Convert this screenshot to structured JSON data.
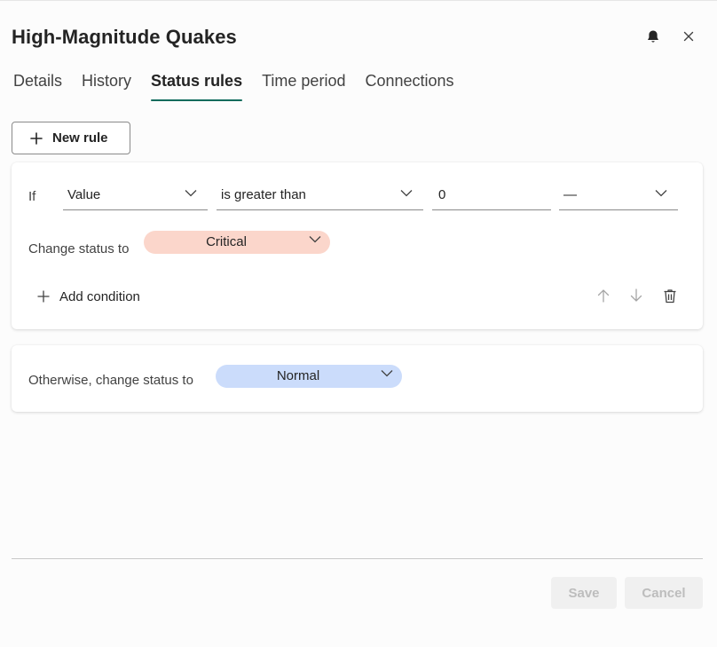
{
  "header": {
    "title": "High-Magnitude Quakes",
    "icons": [
      "bell-icon",
      "close-icon"
    ]
  },
  "tabs": [
    {
      "label": "Details",
      "active": false
    },
    {
      "label": "History",
      "active": false
    },
    {
      "label": "Status rules",
      "active": true
    },
    {
      "label": "Time period",
      "active": false
    },
    {
      "label": "Connections",
      "active": false
    }
  ],
  "toolbar": {
    "new_rule_label": "New rule"
  },
  "rule": {
    "if_label": "If",
    "field": "Value",
    "operator": "is greater than",
    "threshold": "0",
    "unit": "—",
    "change_status_label": "Change status to",
    "status": "Critical",
    "status_color": "#fbd6cb",
    "add_condition_label": "Add condition"
  },
  "otherwise": {
    "label": "Otherwise, change status to",
    "status": "Normal",
    "status_color": "#cbdcfb"
  },
  "footer": {
    "save_label": "Save",
    "cancel_label": "Cancel"
  },
  "colors": {
    "accent": "#0f6b5c"
  }
}
